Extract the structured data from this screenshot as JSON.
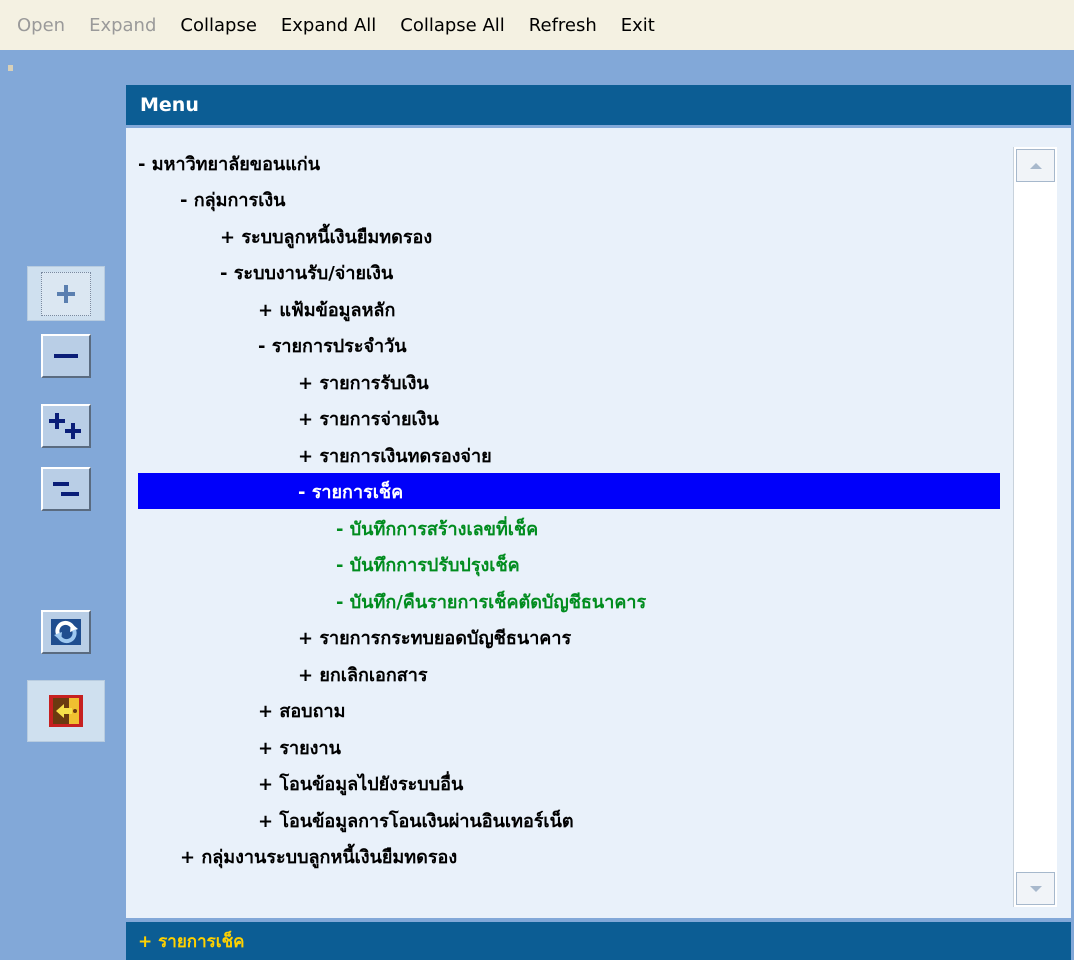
{
  "menubar": {
    "items": [
      {
        "label": "Open",
        "enabled": false
      },
      {
        "label": "Expand",
        "enabled": false
      },
      {
        "label": "Collapse",
        "enabled": true
      },
      {
        "label": "Expand All",
        "enabled": true
      },
      {
        "label": "Collapse All",
        "enabled": true
      },
      {
        "label": "Refresh",
        "enabled": true
      },
      {
        "label": "Exit",
        "enabled": true
      }
    ]
  },
  "toolbar": {
    "buttons": [
      {
        "icon": "expand-icon"
      },
      {
        "icon": "collapse-icon"
      },
      {
        "icon": "expand-all-icon"
      },
      {
        "icon": "collapse-all-icon"
      },
      {
        "icon": "refresh-icon"
      },
      {
        "icon": "exit-icon"
      }
    ]
  },
  "menu": {
    "title": "Menu"
  },
  "tree": {
    "items": [
      {
        "label": "- มหาวิทยาลัยขอนแก่น",
        "level": 0,
        "state": "normal"
      },
      {
        "label": "- กลุ่มการเงิน",
        "level": 1,
        "state": "normal"
      },
      {
        "label": "+ ระบบลูกหนี้เงินยืมทดรอง",
        "level": 2,
        "state": "normal"
      },
      {
        "label": "- ระบบงานรับ/จ่ายเงิน",
        "level": 2,
        "state": "normal"
      },
      {
        "label": "+ แฟ้มข้อมูลหลัก",
        "level": 3,
        "state": "normal"
      },
      {
        "label": "- รายการประจำวัน",
        "level": 3,
        "state": "normal"
      },
      {
        "label": "+ รายการรับเงิน",
        "level": 4,
        "state": "normal"
      },
      {
        "label": "+ รายการจ่ายเงิน",
        "level": 4,
        "state": "normal"
      },
      {
        "label": "+ รายการเงินทดรองจ่าย",
        "level": 4,
        "state": "normal"
      },
      {
        "label": "- รายการเช็ค",
        "level": 4,
        "state": "selected"
      },
      {
        "label": "- บันทึกการสร้างเลขที่เช็ค",
        "level": 5,
        "state": "leaf"
      },
      {
        "label": "- บันทึกการปรับปรุงเช็ค",
        "level": 5,
        "state": "leaf"
      },
      {
        "label": "- บันทึก/คืนรายการเช็คตัดบัญชีธนาคาร",
        "level": 5,
        "state": "leaf"
      },
      {
        "label": "+ รายการกระทบยอดบัญชีธนาคาร",
        "level": 4,
        "state": "normal"
      },
      {
        "label": "+ ยกเลิกเอกสาร",
        "level": 4,
        "state": "normal"
      },
      {
        "label": "+ สอบถาม",
        "level": 3,
        "state": "normal"
      },
      {
        "label": "+ รายงาน",
        "level": 3,
        "state": "normal"
      },
      {
        "label": "+ โอนข้อมูลไปยังระบบอื่น",
        "level": 3,
        "state": "normal"
      },
      {
        "label": "+ โอนข้อมูลการโอนเงินผ่านอินเทอร์เน็ต",
        "level": 3,
        "state": "normal"
      },
      {
        "label": "+ กลุ่มงานระบบลูกหนี้เงินยืมทดรอง",
        "level": 1,
        "state": "normal"
      }
    ]
  },
  "status": {
    "text": "+ รายการเช็ค"
  },
  "colors": {
    "selected_bg": "#0000fa",
    "leaf_text": "#008c1e",
    "header_bg": "#0c5d94",
    "status_text": "#ffd100"
  }
}
